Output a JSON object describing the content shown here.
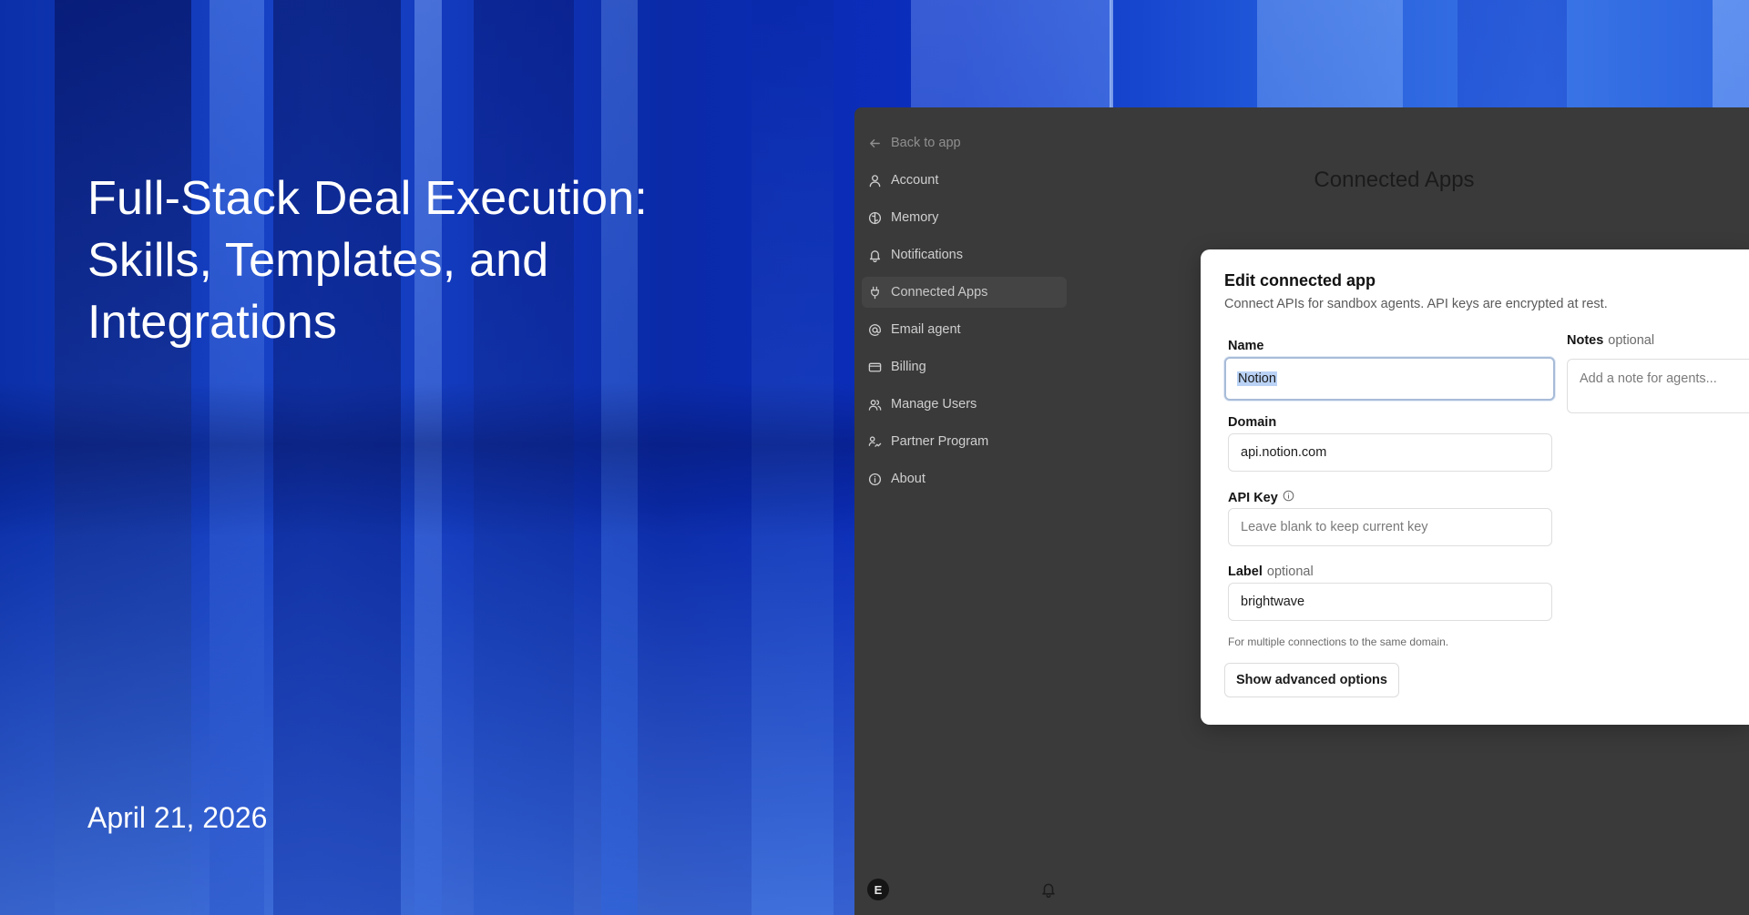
{
  "slide": {
    "title": "Full-Stack Deal Execution: Skills, Templates, and Integrations",
    "date": "April 21, 2026"
  },
  "sidebar": {
    "back": {
      "label": "Back to app",
      "icon": "arrow-left-icon"
    },
    "items": [
      {
        "label": "Account",
        "icon": "user-icon"
      },
      {
        "label": "Memory",
        "icon": "brain-icon"
      },
      {
        "label": "Notifications",
        "icon": "bell-icon"
      },
      {
        "label": "Connected Apps",
        "icon": "plug-icon",
        "active": true
      },
      {
        "label": "Email agent",
        "icon": "at-sign-icon"
      },
      {
        "label": "Billing",
        "icon": "credit-card-icon"
      },
      {
        "label": "Manage Users",
        "icon": "users-icon"
      },
      {
        "label": "Partner Program",
        "icon": "handshake-icon"
      },
      {
        "label": "About",
        "icon": "info-icon"
      }
    ],
    "avatar_initial": "E"
  },
  "page": {
    "title": "Connected Apps"
  },
  "modal": {
    "title": "Edit connected app",
    "subtitle": "Connect APIs for sandbox agents. API keys are encrypted at rest.",
    "name": {
      "label": "Name",
      "value": "Notion"
    },
    "domain": {
      "label": "Domain",
      "value": "api.notion.com"
    },
    "api_key": {
      "label": "API Key",
      "placeholder": "Leave blank to keep current key"
    },
    "label": {
      "label": "Label",
      "optional": "optional",
      "value": "brightwave",
      "hint": "For multiple connections to the same domain."
    },
    "notes": {
      "label": "Notes",
      "optional": "optional",
      "placeholder": "Add a note for agents..."
    },
    "advanced_button": "Show advanced options"
  },
  "colors": {
    "app_background": "#3a3a3a",
    "modal_background": "#ffffff",
    "selection": "#b9d2f5"
  }
}
